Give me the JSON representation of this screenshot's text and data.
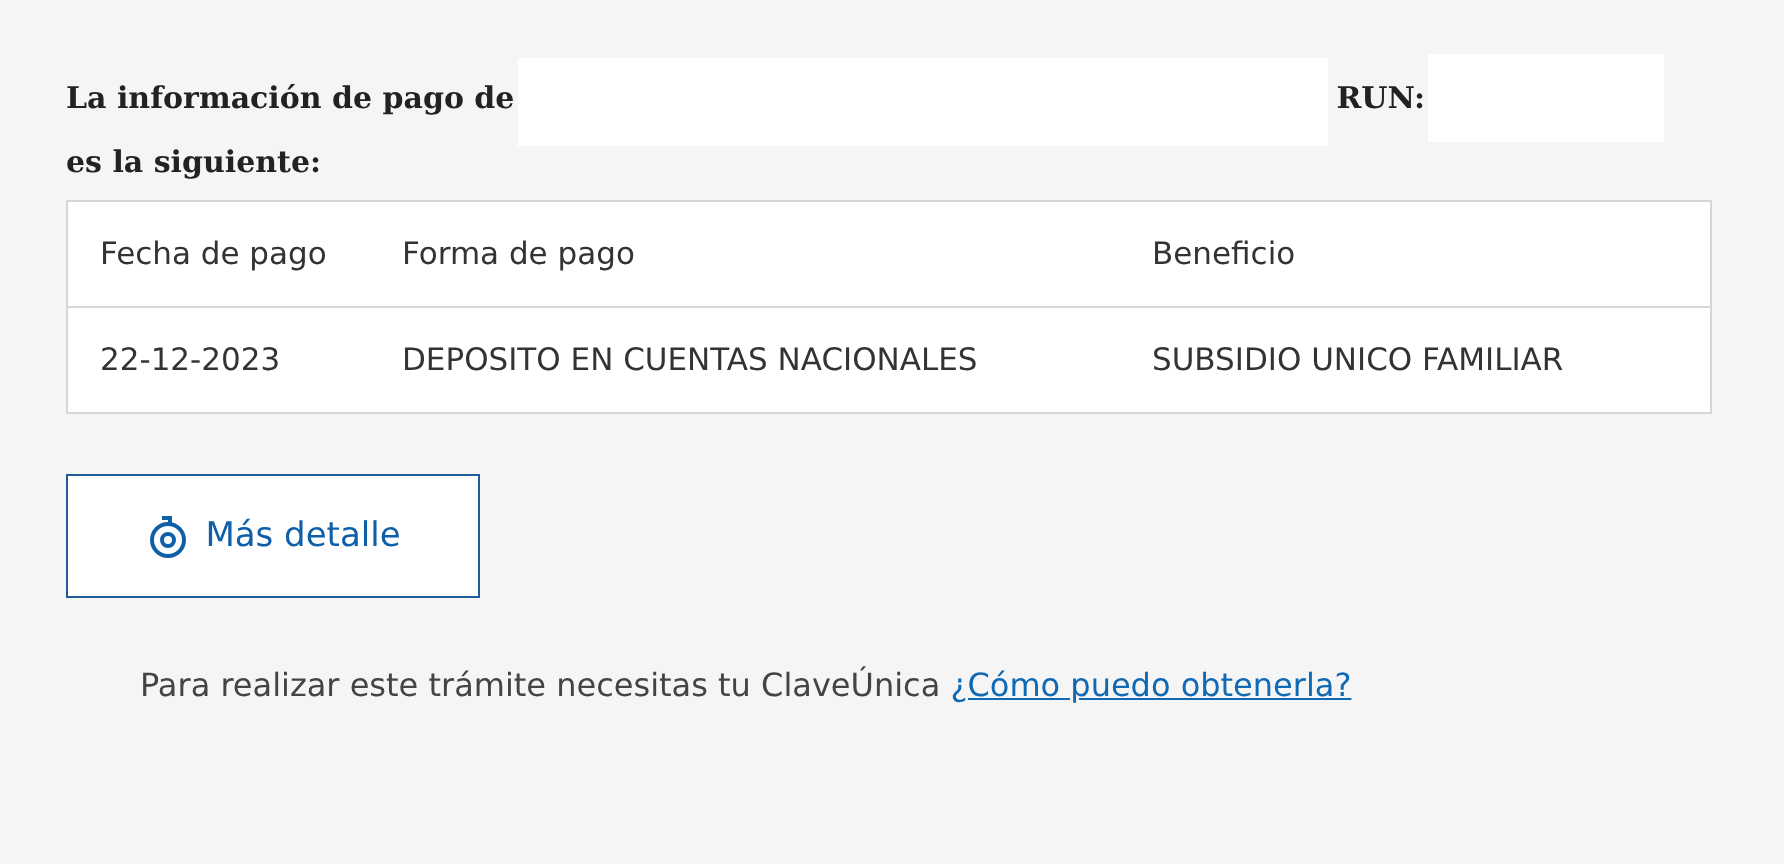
{
  "heading": {
    "intro": "La información de pago de",
    "run_label": "RUN:",
    "continuation": "es la siguiente:"
  },
  "table": {
    "columns": [
      "Fecha de pago",
      "Forma de pago",
      "Beneficio"
    ],
    "rows": [
      [
        "22-12-2023",
        "DEPOSITO EN CUENTAS NACIONALES",
        "SUBSIDIO UNICO FAMILIAR"
      ]
    ]
  },
  "detail_button": {
    "label": "Más detalle"
  },
  "footer": {
    "text": "Para realizar este trámite necesitas tu ClaveÚnica",
    "link": "¿Cómo puedo obtenerla?"
  }
}
